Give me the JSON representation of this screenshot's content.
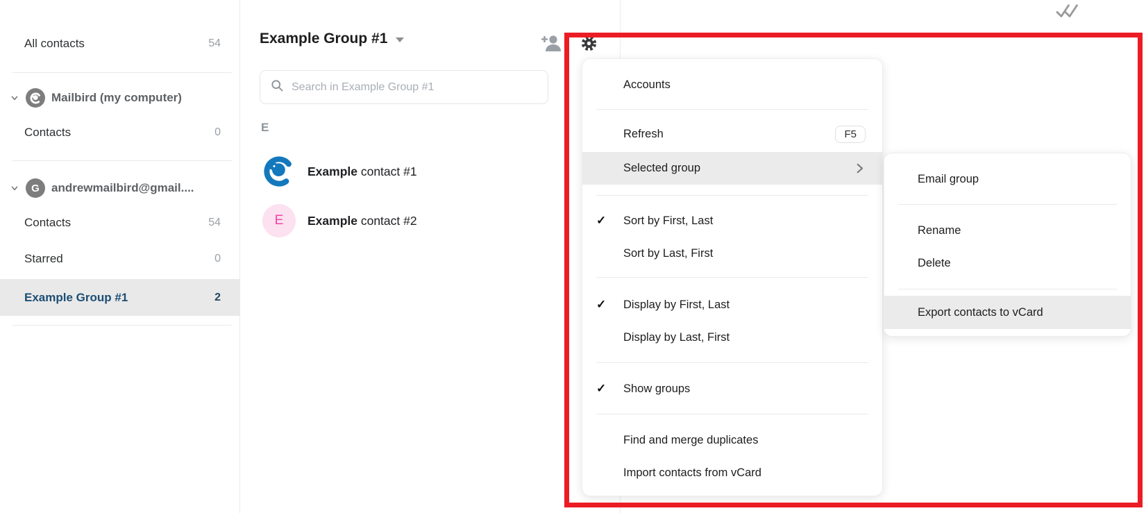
{
  "colors": {
    "annotation_red": "#EC1C24",
    "selected_navy": "#1C4E74",
    "mailbird_blue": "#1478BC",
    "pink_avatar_bg": "#FCE1F0",
    "pink_avatar_fg": "#F243A5",
    "menu_highlight": "#EBEBEB"
  },
  "icons": {
    "check": "✓",
    "double_check": "double-check-mark",
    "gear": "settings-gear",
    "search": "magnifier",
    "add_contact": "person-plus",
    "chevron_down": "chevron-down",
    "chevron_right": "chevron-right",
    "dropdown": "triangle-down"
  },
  "sidebar": {
    "all_contacts": {
      "label": "All contacts",
      "count": "54"
    },
    "accounts": [
      {
        "name": "Mailbird (my computer)",
        "avatar": "mailbird-logo",
        "items": [
          {
            "label": "Contacts",
            "count": "0"
          }
        ]
      },
      {
        "name": "andrewmailbird@gmail....",
        "avatar_letter": "G",
        "items": [
          {
            "label": "Contacts",
            "count": "54"
          },
          {
            "label": "Starred",
            "count": "0"
          },
          {
            "label": "Example Group #1",
            "count": "2",
            "selected": true
          }
        ]
      }
    ]
  },
  "header": {
    "title": "Example Group #1"
  },
  "search": {
    "placeholder": "Search in Example Group #1"
  },
  "contact_list": {
    "section": "E",
    "contacts": [
      {
        "name_bold": "Example",
        "name_rest": " contact #1",
        "avatar": "mailbird-logo"
      },
      {
        "name_bold": "Example",
        "name_rest": " contact #2",
        "initial": "E"
      }
    ]
  },
  "gear_menu": {
    "items": [
      {
        "label": "Accounts"
      },
      {
        "label": "Refresh",
        "shortcut": "F5"
      },
      {
        "label": "Selected group",
        "highlighted": true,
        "has_submenu": true
      },
      {
        "label": "Sort by First, Last",
        "checked": true
      },
      {
        "label": "Sort by Last, First"
      },
      {
        "label": "Display by First, Last",
        "checked": true
      },
      {
        "label": "Display by Last, First"
      },
      {
        "label": "Show groups",
        "checked": true
      },
      {
        "label": "Find and merge duplicates"
      },
      {
        "label": "Import contacts from vCard"
      }
    ]
  },
  "group_submenu": {
    "items": [
      {
        "label": "Email group"
      },
      {
        "label": "Rename"
      },
      {
        "label": "Delete"
      },
      {
        "label": "Export contacts to vCard",
        "highlighted": true
      }
    ]
  }
}
